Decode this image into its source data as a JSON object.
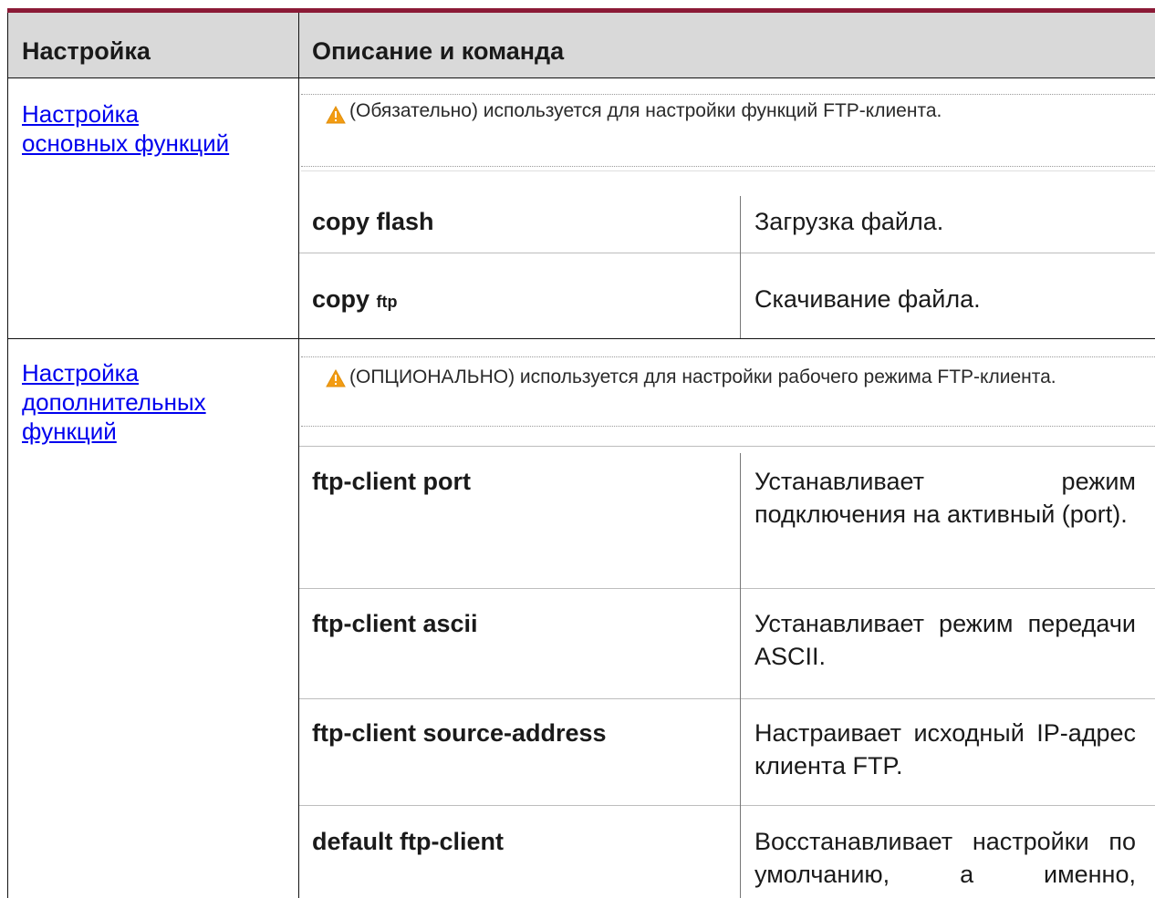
{
  "header": {
    "col1": "Настройка",
    "col2": "Описание и команда"
  },
  "sections": [
    {
      "link": "Настройка основных функций",
      "link_line1": "Настройка",
      "link_line2": "основных функций",
      "note_icon": "warning-icon",
      "note": "(Обязательно) используется для настройки функций FTP-клиента.",
      "rows": [
        {
          "cmd": "copy flash",
          "desc": "Загрузка файла."
        },
        {
          "cmd_bold": "copy",
          "cmd_small": "ftp",
          "desc": "Скачивание файла."
        }
      ]
    },
    {
      "link": "Настройка дополнительных функций",
      "link_line1": "Настройка",
      "link_line2": "дополнительных",
      "link_line3": "функций",
      "note_icon": "warning-icon",
      "note": "(ОПЦИОНАЛЬНО) используется для настройки рабочего режима FTP-клиента.",
      "rows": [
        {
          "cmd": "ftp-client port",
          "desc": "Устанавливает режим подключения на активный (port)."
        },
        {
          "cmd": "ftp-client ascii",
          "desc": "Устанавливает режим передачи ASCII."
        },
        {
          "cmd": "ftp-client source-address",
          "desc": "Настраивает исходный IP-адрес клиента FTP."
        },
        {
          "cmd": "default ftp-client",
          "desc": "Восстанавливает настройки по умолчанию, а именно,"
        }
      ]
    }
  ],
  "colors": {
    "accent_bar": "#8b1a36",
    "header_bg": "#d9d9d9",
    "link": "#0000ee",
    "warning": "#f39c12"
  }
}
